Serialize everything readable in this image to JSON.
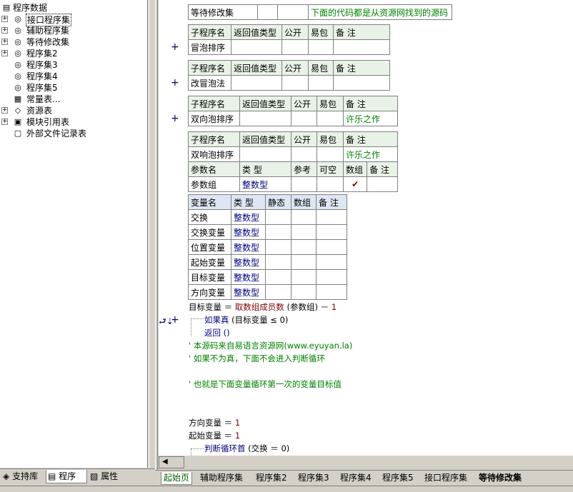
{
  "tree": {
    "root": "程序数据",
    "items": [
      "接口程序集",
      "辅助程序集",
      "等待修改集",
      "程序集2",
      "程序集3",
      "程序集4",
      "程序集5",
      "常量表...",
      "资源表",
      "模块引用表",
      "外部文件记录表"
    ]
  },
  "left_tabs": [
    "支持库",
    "程序",
    "属性"
  ],
  "pending": {
    "name": "等待修改集",
    "note": "下面的代码都是从资源网找到的源码"
  },
  "hdr": {
    "sub_name": "子程序名",
    "ret_type": "返回值类型",
    "public": "公开",
    "easy": "易包",
    "note": "备 注"
  },
  "subs": [
    {
      "name": "冒泡排序",
      "note": ""
    },
    {
      "name": "改冒泡法",
      "note": ""
    },
    {
      "name": "双向泡排序",
      "note": "许乐之作"
    },
    {
      "name": "双响泡排序",
      "note": "许乐之作"
    }
  ],
  "param_hdr": {
    "name": "参数名",
    "type": "类 型",
    "ref": "参考",
    "nullable": "可空",
    "array": "数组",
    "note": "备 注"
  },
  "params": [
    {
      "name": "参数组",
      "type": "整数型",
      "array_mark": "✔"
    }
  ],
  "var_hdr": {
    "name": "变量名",
    "type": "类 型",
    "static": "静态",
    "array": "数组",
    "note": "备 注"
  },
  "vars": [
    {
      "name": "交换",
      "type": "整数型"
    },
    {
      "name": "交换变量",
      "type": "整数型"
    },
    {
      "name": "位置变量",
      "type": "整数型"
    },
    {
      "name": "起始变量",
      "type": "整数型"
    },
    {
      "name": "目标变量",
      "type": "整数型"
    },
    {
      "name": "方向变量",
      "type": "整数型"
    }
  ],
  "code": {
    "l1a": "目标变量 ＝ ",
    "l1b": "取数组成员数",
    "l1c": " (参数组) － ",
    "l1d": "1",
    "l2a": "如果真",
    "l2b": " (目标变量 ≤ 0)",
    "l3": "返回 ()",
    "c1": "' 本源码来自易语言资源网(www.eyuyan.la)",
    "c2": "' 如果不为真，下面不会进入判断循环",
    "c3": "' 也就是下面变量循环第一次的变量目标值",
    "l4a": "方向变量 ＝ ",
    "l4b": "1",
    "l5a": "起始变量 ＝ ",
    "l5b": "1",
    "l6a": "判断循环首",
    "l6b": " (交换 ＝ 0)"
  },
  "bottom_tabs": [
    "起始页",
    "辅助程序集",
    "程序集2",
    "程序集3",
    "程序集4",
    "程序集5",
    "接口程序集",
    "等待修改集"
  ]
}
